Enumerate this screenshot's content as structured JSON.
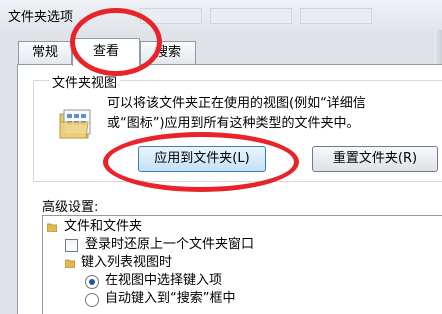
{
  "window": {
    "title": "文件夹选项"
  },
  "tabs": [
    {
      "label": "常规"
    },
    {
      "label": "查看"
    },
    {
      "label": "搜索"
    }
  ],
  "folder_views": {
    "legend": "文件夹视图",
    "description_line1": "可以将该文件夹正在使用的视图(例如“详细信",
    "description_line2": "或“图标”)应用到所有这种类型的文件夹中。",
    "apply_button": "应用到文件夹(L)",
    "reset_button": "重置文件夹(R)"
  },
  "advanced": {
    "label": "高级设置:",
    "items": [
      {
        "type": "folder",
        "label": "文件和文件夹"
      },
      {
        "type": "checkbox",
        "label": "登录时还原上一个文件夹窗口",
        "checked": false
      },
      {
        "type": "folder",
        "label": "键入列表视图时"
      },
      {
        "type": "radio",
        "label": "在视图中选择键入项",
        "selected": true
      },
      {
        "type": "radio",
        "label": "自动键入到“搜索”框中",
        "selected": false
      }
    ]
  },
  "colors": {
    "annotation_ring": "#e8242a",
    "accent": "#3c7fb1"
  }
}
